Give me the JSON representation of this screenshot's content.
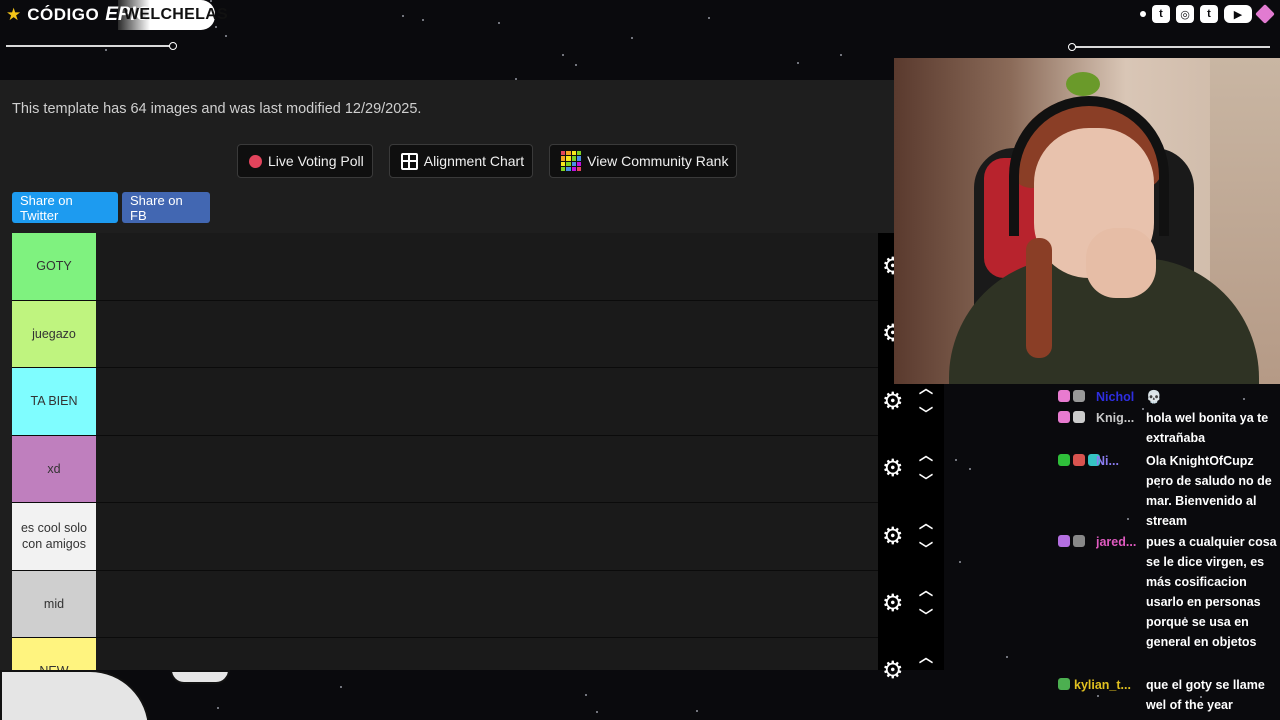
{
  "overlay": {
    "brand_code": "CÓDIGO",
    "brand_epic": "EPIC",
    "brand_channel": "WELCHELAS",
    "social_icons": [
      "twitch-icon",
      "instagram-icon",
      "twitter-icon",
      "youtube-icon",
      "gem-icon"
    ]
  },
  "page": {
    "info_text": "This template has 64 images and was last modified 12/29/2025.",
    "buttons": {
      "live_poll": "Live Voting Poll",
      "alignment": "Alignment Chart",
      "community_rank": "View Community Rank"
    },
    "share": {
      "twitter": "Share on Twitter",
      "fb": "Share on FB"
    },
    "tiers": [
      {
        "label": "GOTY",
        "color": "#7ff27f"
      },
      {
        "label": "juegazo",
        "color": "#bff47f"
      },
      {
        "label": "TA BIEN",
        "color": "#7ffdff"
      },
      {
        "label": "xd",
        "color": "#bf7fbe"
      },
      {
        "label": "es cool solo con amigos",
        "color": "#f2f2f2"
      },
      {
        "label": "mid",
        "color": "#cfcfcf"
      },
      {
        "label": "NEW",
        "color": "#fff47f"
      }
    ]
  },
  "chat": {
    "messages": [
      {
        "user": "Nichol",
        "color": "#2e2ee0",
        "text": "💀"
      },
      {
        "user": "Knig...",
        "color": "#c8c8c8",
        "text": "hola wel bonita ya te extrañaba"
      },
      {
        "user": "Ni...",
        "color": "#8a7cf0",
        "text": "Ola KnightOfCupz pero de saludo no de mar. Bienvenido al stream"
      },
      {
        "user": "jared...",
        "color": "#e05ac0",
        "text": "pues a cualquier cosa se le dice virgen, es más cosificacion usarlo en personas porque se usa en general en objetos"
      },
      {
        "user": "kylian_t...",
        "color": "#e0c020",
        "text": "que el goty se llame wel of the year"
      }
    ]
  }
}
